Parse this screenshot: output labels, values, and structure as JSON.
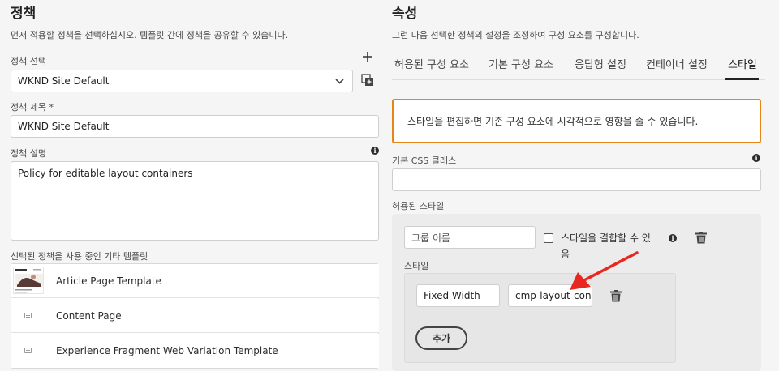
{
  "policy": {
    "title": "정책",
    "description": "먼저 적용할 정책을 선택하십시오. 템플릿 간에 정책을 공유할 수 있습니다.",
    "select_label": "정책 선택",
    "selected_policy": "WKND Site Default",
    "title_label": "정책 제목 *",
    "title_value": "WKND Site Default",
    "desc_label": "정책 설명",
    "desc_value": "Policy for editable layout containers",
    "templates_label": "선택된 정책을 사용 중인 기타 템플릿",
    "templates": [
      {
        "name": "Article Page Template",
        "thumb": "image"
      },
      {
        "name": "Content Page",
        "thumb": "generic"
      },
      {
        "name": "Experience Fragment Web Variation Template",
        "thumb": "generic"
      }
    ]
  },
  "properties": {
    "title": "속성",
    "description": "그런 다음 선택한 정책의 설정을 조정하여 구성 요소를 구성합니다.",
    "tabs": [
      {
        "label": "허용된 구성 요소"
      },
      {
        "label": "기본 구성 요소"
      },
      {
        "label": "응답형 설정"
      },
      {
        "label": "컨테이너 설정"
      },
      {
        "label": "스타일",
        "active": true
      }
    ],
    "warning": "스타일을 편집하면 기존 구성 요소에 시각적으로 영향을 줄 수 있습니다.",
    "css_label": "기본 CSS 클래스",
    "css_value": "",
    "allowed_styles_label": "허용된 스타일",
    "group_name_placeholder": "그룹 이름",
    "combine_label": "스타일을 결합할 수 있음",
    "combine_checked": false,
    "styles_label": "스타일",
    "style_name": "Fixed Width",
    "style_class": "cmp-layout-con",
    "add_label": "추가"
  },
  "colors": {
    "warning_border": "#e68619",
    "arrow": "#e8271e"
  }
}
